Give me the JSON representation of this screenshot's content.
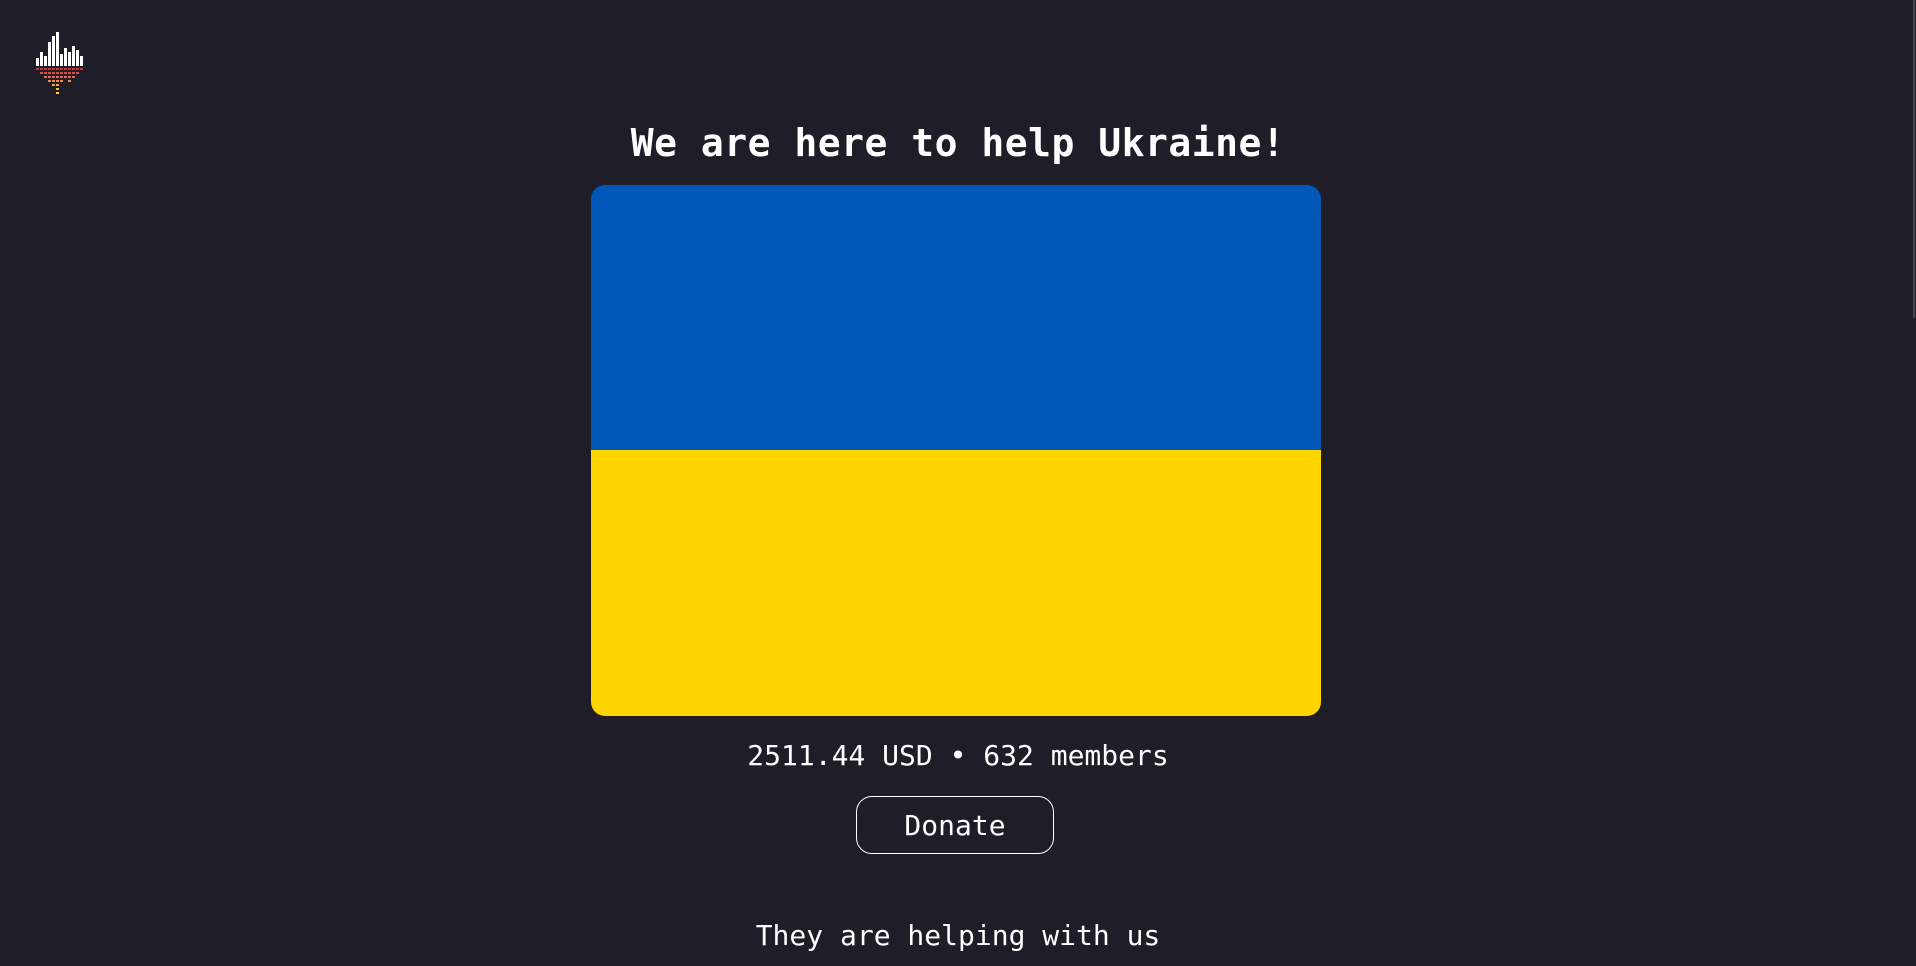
{
  "logo": {
    "icon": "equalizer-logo-icon"
  },
  "header": {
    "title": "We are here to help Ukraine!"
  },
  "flag": {
    "top_color": "#0057b8",
    "bottom_color": "#ffd500"
  },
  "stats": {
    "text": "2511.44 USD • 632 members"
  },
  "actions": {
    "donate_label": "Donate"
  },
  "section": {
    "helpers_heading": "They are helping with us"
  }
}
